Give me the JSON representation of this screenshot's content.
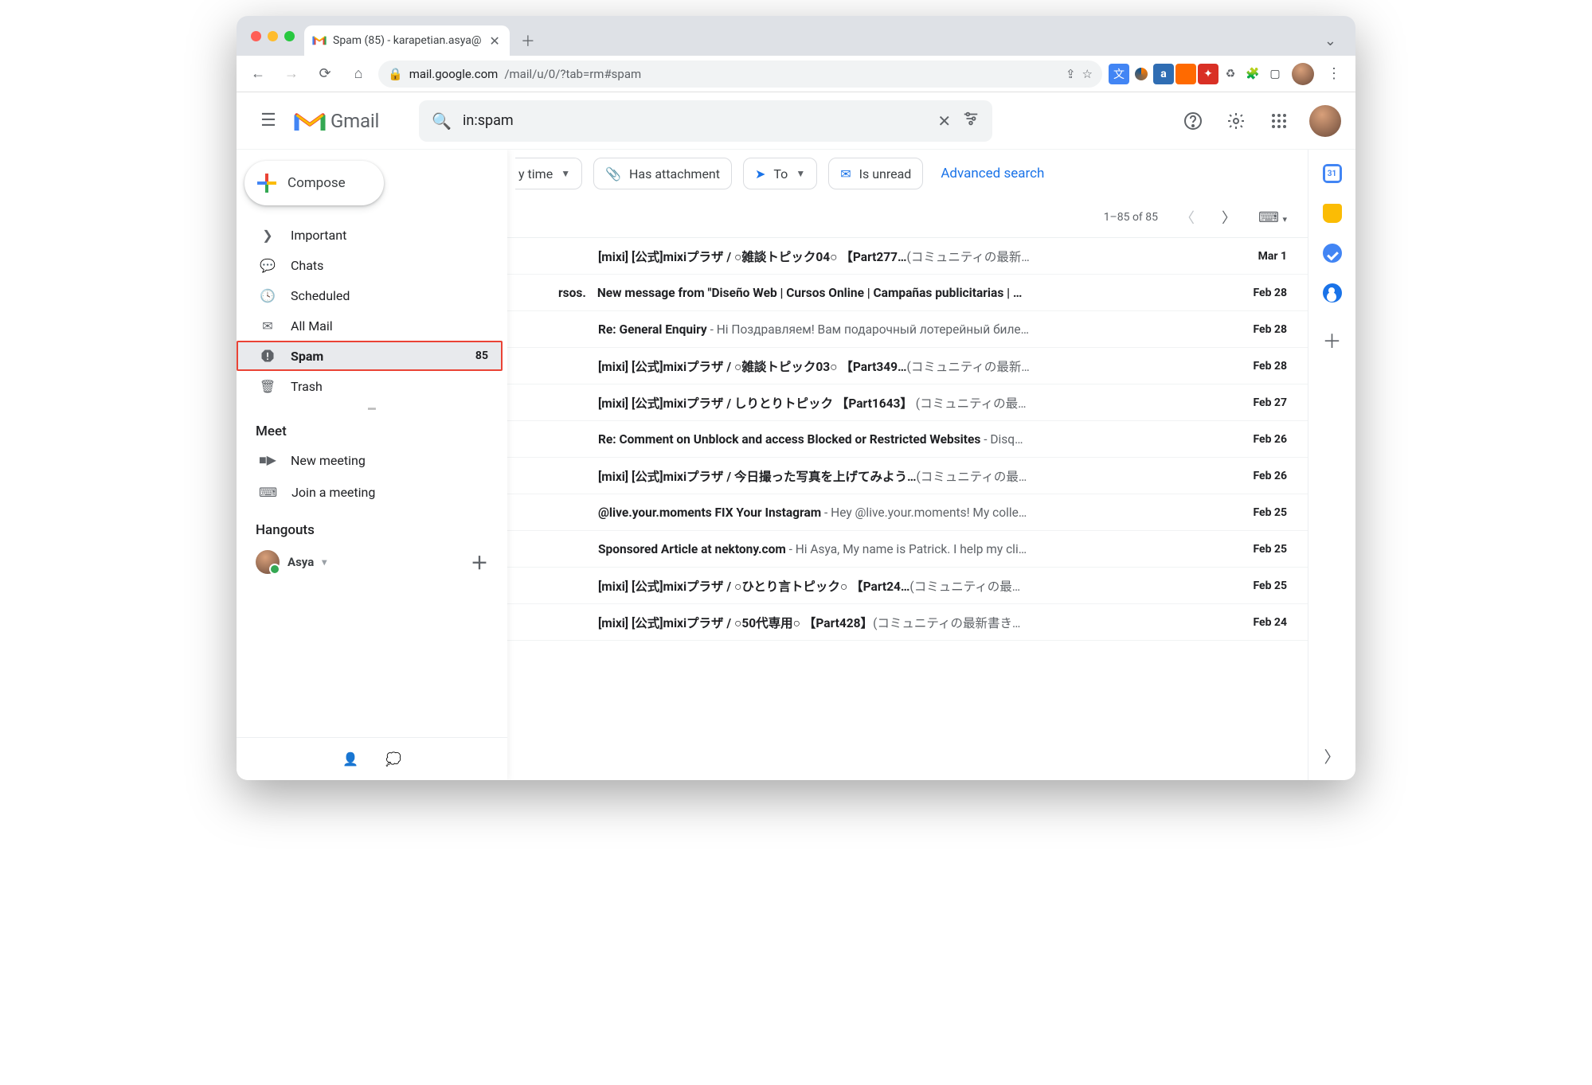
{
  "browser": {
    "tab_title": "Spam (85) - karapetian.asya@",
    "url_host": "mail.google.com",
    "url_path": "/mail/u/0/?tab=rm#spam"
  },
  "header": {
    "product": "Gmail",
    "search_value": "in:spam"
  },
  "compose_label": "Compose",
  "sidebar": {
    "items": [
      {
        "icon": "label-important",
        "label": "Important",
        "count": ""
      },
      {
        "icon": "chat-bubble",
        "label": "Chats",
        "count": ""
      },
      {
        "icon": "schedule-send",
        "label": "Scheduled",
        "count": ""
      },
      {
        "icon": "all-mail",
        "label": "All Mail",
        "count": ""
      },
      {
        "icon": "spam",
        "label": "Spam",
        "count": "85"
      },
      {
        "icon": "trash",
        "label": "Trash",
        "count": ""
      }
    ],
    "meet_header": "Meet",
    "meet": [
      {
        "icon": "videocam",
        "label": "New meeting"
      },
      {
        "icon": "keyboard",
        "label": "Join a meeting"
      }
    ],
    "hangouts_header": "Hangouts",
    "hangouts_user": "Asya"
  },
  "chips": {
    "any_time": "y time",
    "has_attachment": "Has attachment",
    "to": "To",
    "is_unread": "Is unread",
    "advanced": "Advanced search"
  },
  "toolbar": {
    "range": "1–85 of 85"
  },
  "emails": [
    {
      "sender_cut": "",
      "subject": "[mixi] [公式]mixiプラザ / ○雑談トピック04○ 【Part277…",
      "preview": "(コミュニティの最新…",
      "date": "Mar 1"
    },
    {
      "sender_cut": "rsos.",
      "subject": "New message from \"Diseño Web | Cursos Online | Campañas publicitarias | …",
      "preview": "",
      "date": "Feb 28"
    },
    {
      "sender_cut": "",
      "subject": "Re: General Enquiry",
      "preview": " - Ні Поздравляем! Вам подарочный лотерейный биле…",
      "date": "Feb 28"
    },
    {
      "sender_cut": "",
      "subject": "[mixi] [公式]mixiプラザ / ○雑談トピック03○ 【Part349…",
      "preview": "(コミュニティの最新…",
      "date": "Feb 28"
    },
    {
      "sender_cut": "",
      "subject": "[mixi] [公式]mixiプラザ / しりとりトピック 【Part1643】",
      "preview": " (コミュニティの最…",
      "date": "Feb 27"
    },
    {
      "sender_cut": "",
      "subject": "Re: Comment on Unblock and access Blocked or Restricted Websites",
      "preview": " - Disq…",
      "date": "Feb 26"
    },
    {
      "sender_cut": "",
      "subject": "[mixi] [公式]mixiプラザ / 今日撮った写真を上げてみよう…",
      "preview": "(コミュニティの最…",
      "date": "Feb 26"
    },
    {
      "sender_cut": "",
      "subject": "@live.your.moments FIX Your Instagram",
      "preview": " - Hey @live.your.moments! My colle…",
      "date": "Feb 25"
    },
    {
      "sender_cut": "",
      "subject": "Sponsored Article at nektony.com",
      "preview": " - Hi Asya, My name is Patrick. I help my cli…",
      "date": "Feb 25"
    },
    {
      "sender_cut": "",
      "subject": "[mixi] [公式]mixiプラザ / ○ひとり言トピック○ 【Part24…",
      "preview": "(コミュニティの最…",
      "date": "Feb 25"
    },
    {
      "sender_cut": "",
      "subject": "[mixi] [公式]mixiプラザ / ○50代専用○ 【Part428】",
      "preview": "(コミュニティの最新書き…",
      "date": "Feb 24"
    }
  ]
}
